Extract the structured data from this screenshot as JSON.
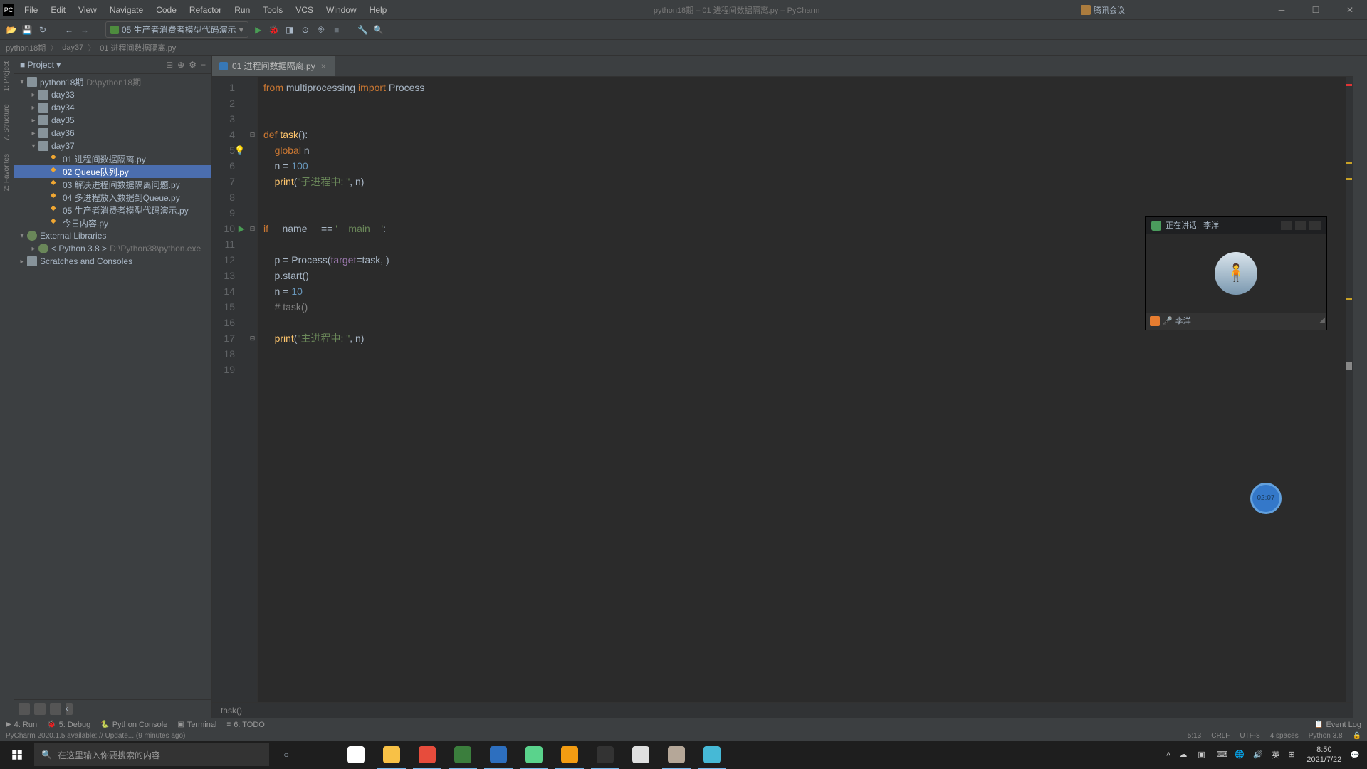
{
  "titlebar": {
    "menus": [
      "File",
      "Edit",
      "View",
      "Navigate",
      "Code",
      "Refactor",
      "Run",
      "Tools",
      "VCS",
      "Window",
      "Help"
    ],
    "title": "python18期 – 01 进程间数据隔离.py – PyCharm",
    "overlay_app": "腾讯会议"
  },
  "toolbar": {
    "run_config": "05 生产者消费者模型代码演示"
  },
  "breadcrumb": {
    "items": [
      "python18期",
      "day37",
      "01 进程间数据隔离.py"
    ]
  },
  "project": {
    "header": "Project",
    "root": "python18期",
    "root_path": "D:\\python18期",
    "days": [
      "day33",
      "day34",
      "day35",
      "day36"
    ],
    "day_open": "day37",
    "files": [
      "01 进程间数据隔离.py",
      "02 Queue队列.py",
      "03 解决进程间数据隔离问题.py",
      "04 多进程放入数据到Queue.py",
      "05 生产者消费者模型代码演示.py",
      "今日内容.py"
    ],
    "selected_index": 1,
    "external": "External Libraries",
    "python_env": "< Python 3.8 >",
    "python_path": "D:\\Python38\\python.exe",
    "scratches": "Scratches and Consoles"
  },
  "editor": {
    "tab_name": "01 进程间数据隔离.py",
    "code": [
      {
        "n": 1,
        "tokens": [
          {
            "c": "kw",
            "t": "from "
          },
          {
            "c": "plain",
            "t": "multiprocessing "
          },
          {
            "c": "kw",
            "t": "import "
          },
          {
            "c": "plain",
            "t": "Process"
          }
        ]
      },
      {
        "n": 2,
        "tokens": []
      },
      {
        "n": 3,
        "tokens": []
      },
      {
        "n": 4,
        "tokens": [
          {
            "c": "kw",
            "t": "def "
          },
          {
            "c": "fn",
            "t": "task"
          },
          {
            "c": "plain",
            "t": "():"
          }
        ],
        "fold": true,
        "run": false
      },
      {
        "n": 5,
        "tokens": [
          {
            "c": "plain",
            "t": "    "
          },
          {
            "c": "kw",
            "t": "global "
          },
          {
            "c": "plain",
            "t": "n"
          }
        ],
        "bulb": true
      },
      {
        "n": 6,
        "tokens": [
          {
            "c": "plain",
            "t": "    n = "
          },
          {
            "c": "num",
            "t": "100"
          }
        ]
      },
      {
        "n": 7,
        "tokens": [
          {
            "c": "plain",
            "t": "    "
          },
          {
            "c": "fn",
            "t": "print"
          },
          {
            "c": "plain",
            "t": "("
          },
          {
            "c": "str",
            "t": "\"子进程中: \""
          },
          {
            "c": "plain",
            "t": ", n)"
          }
        ]
      },
      {
        "n": 8,
        "tokens": []
      },
      {
        "n": 9,
        "tokens": []
      },
      {
        "n": 10,
        "tokens": [
          {
            "c": "kw",
            "t": "if "
          },
          {
            "c": "plain",
            "t": "__name__ == "
          },
          {
            "c": "str",
            "t": "'__main__'"
          },
          {
            "c": "plain",
            "t": ":"
          }
        ],
        "fold": true,
        "run": true
      },
      {
        "n": 11,
        "tokens": []
      },
      {
        "n": 12,
        "tokens": [
          {
            "c": "plain",
            "t": "    p = Process("
          },
          {
            "c": "param",
            "t": "target"
          },
          {
            "c": "plain",
            "t": "=task, )"
          }
        ]
      },
      {
        "n": 13,
        "tokens": [
          {
            "c": "plain",
            "t": "    p.start()"
          }
        ]
      },
      {
        "n": 14,
        "tokens": [
          {
            "c": "plain",
            "t": "    n = "
          },
          {
            "c": "num",
            "t": "10"
          }
        ]
      },
      {
        "n": 15,
        "tokens": [
          {
            "c": "plain",
            "t": "    "
          },
          {
            "c": "cmt",
            "t": "# task()"
          }
        ]
      },
      {
        "n": 16,
        "tokens": []
      },
      {
        "n": 17,
        "tokens": [
          {
            "c": "plain",
            "t": "    "
          },
          {
            "c": "fn",
            "t": "print"
          },
          {
            "c": "plain",
            "t": "("
          },
          {
            "c": "str",
            "t": "\"主进程中: \""
          },
          {
            "c": "plain",
            "t": ", n)"
          }
        ],
        "fold": true
      },
      {
        "n": 18,
        "tokens": []
      },
      {
        "n": 19,
        "tokens": []
      }
    ],
    "crumb": "task()"
  },
  "meeting": {
    "speaking_label": "正在讲话:",
    "speaker": "李洋",
    "footer_name": "李洋"
  },
  "timer": "02:07",
  "side_tabs_left": [
    "1: Project",
    "7. Structure",
    "2: Favorites"
  ],
  "tool_tabs": {
    "left": [
      {
        "icon": "▶",
        "label": "4: Run"
      },
      {
        "icon": "🐞",
        "label": "5: Debug"
      },
      {
        "icon": "🐍",
        "label": "Python Console"
      },
      {
        "icon": "▣",
        "label": "Terminal"
      },
      {
        "icon": "≡",
        "label": "6: TODO"
      }
    ],
    "right": {
      "icon": "📋",
      "label": "Event Log"
    }
  },
  "status": {
    "left": "PyCharm 2020.1.5 available: // Update... (9 minutes ago)",
    "caret": "5:13",
    "eol": "CRLF",
    "enc": "UTF-8",
    "indent": "4 spaces",
    "interp": "Python 3.8"
  },
  "win_taskbar": {
    "search_placeholder": "在这里输入你要搜索的内容",
    "apps": [
      {
        "color": "#fff",
        "active": false
      },
      {
        "color": "#f8c146",
        "active": true
      },
      {
        "color": "#e74c3c",
        "active": true
      },
      {
        "color": "#3b7e3d",
        "active": true
      },
      {
        "color": "#2d6fbf",
        "active": true
      },
      {
        "color": "#5ad38c",
        "active": true
      },
      {
        "color": "#f39c12",
        "active": true
      },
      {
        "color": "#333",
        "active": true
      },
      {
        "color": "#e0e0e0",
        "active": false
      },
      {
        "color": "#b5a798",
        "active": true
      },
      {
        "color": "#46b9d6",
        "active": true
      }
    ],
    "ime": "英",
    "time": "8:50",
    "date": "2021/7/22"
  }
}
